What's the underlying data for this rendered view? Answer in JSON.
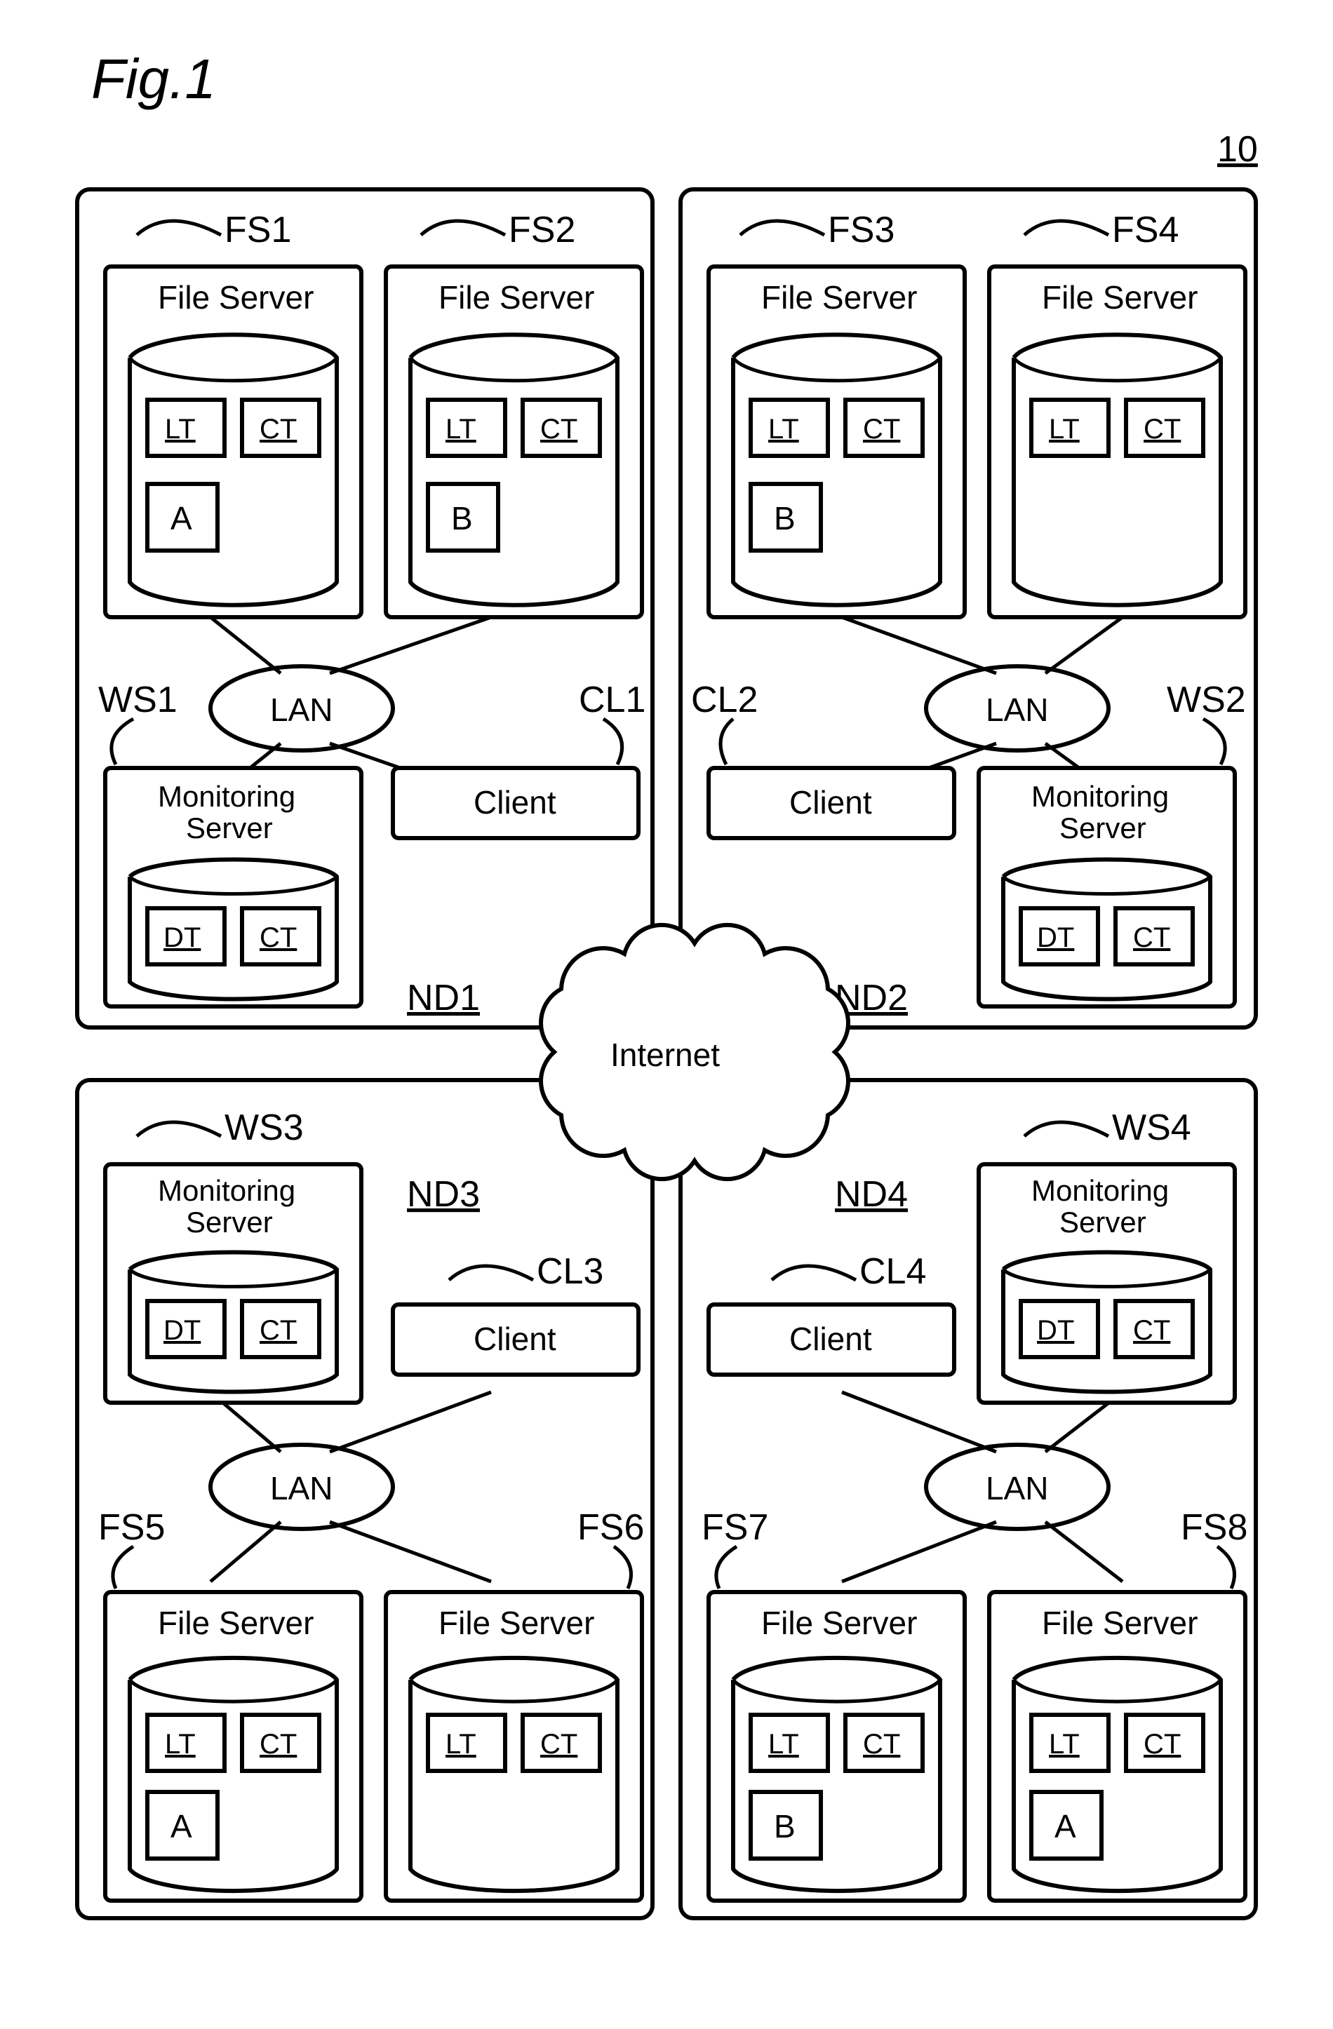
{
  "figureLabel": "Fig.1",
  "topRightLabel": "10",
  "internetLabel": "Internet",
  "lanLabel": "LAN",
  "monitoringServerLabel": "Monitoring",
  "monitoringServerLabel2": "Server",
  "clientLabel": "Client",
  "fileServerLabel": "File Server",
  "dtLabel": "DT",
  "ctLabel": "CT",
  "ltLabel": "LT",
  "nodes": {
    "nd1": {
      "label": "ND1",
      "fs1": "FS1",
      "fs2": "FS2",
      "ws": "WS1",
      "cl": "CL1",
      "fileA": "A",
      "fileB": "B"
    },
    "nd2": {
      "label": "ND2",
      "fs3": "FS3",
      "fs4": "FS4",
      "ws": "WS2",
      "cl": "CL2",
      "fileB": "B"
    },
    "nd3": {
      "label": "ND3",
      "fs5": "FS5",
      "fs6": "FS6",
      "ws": "WS3",
      "cl": "CL3",
      "fileA": "A"
    },
    "nd4": {
      "label": "ND4",
      "fs7": "FS7",
      "fs8": "FS8",
      "ws": "WS4",
      "cl": "CL4",
      "fileB": "B",
      "fileA": "A"
    }
  }
}
